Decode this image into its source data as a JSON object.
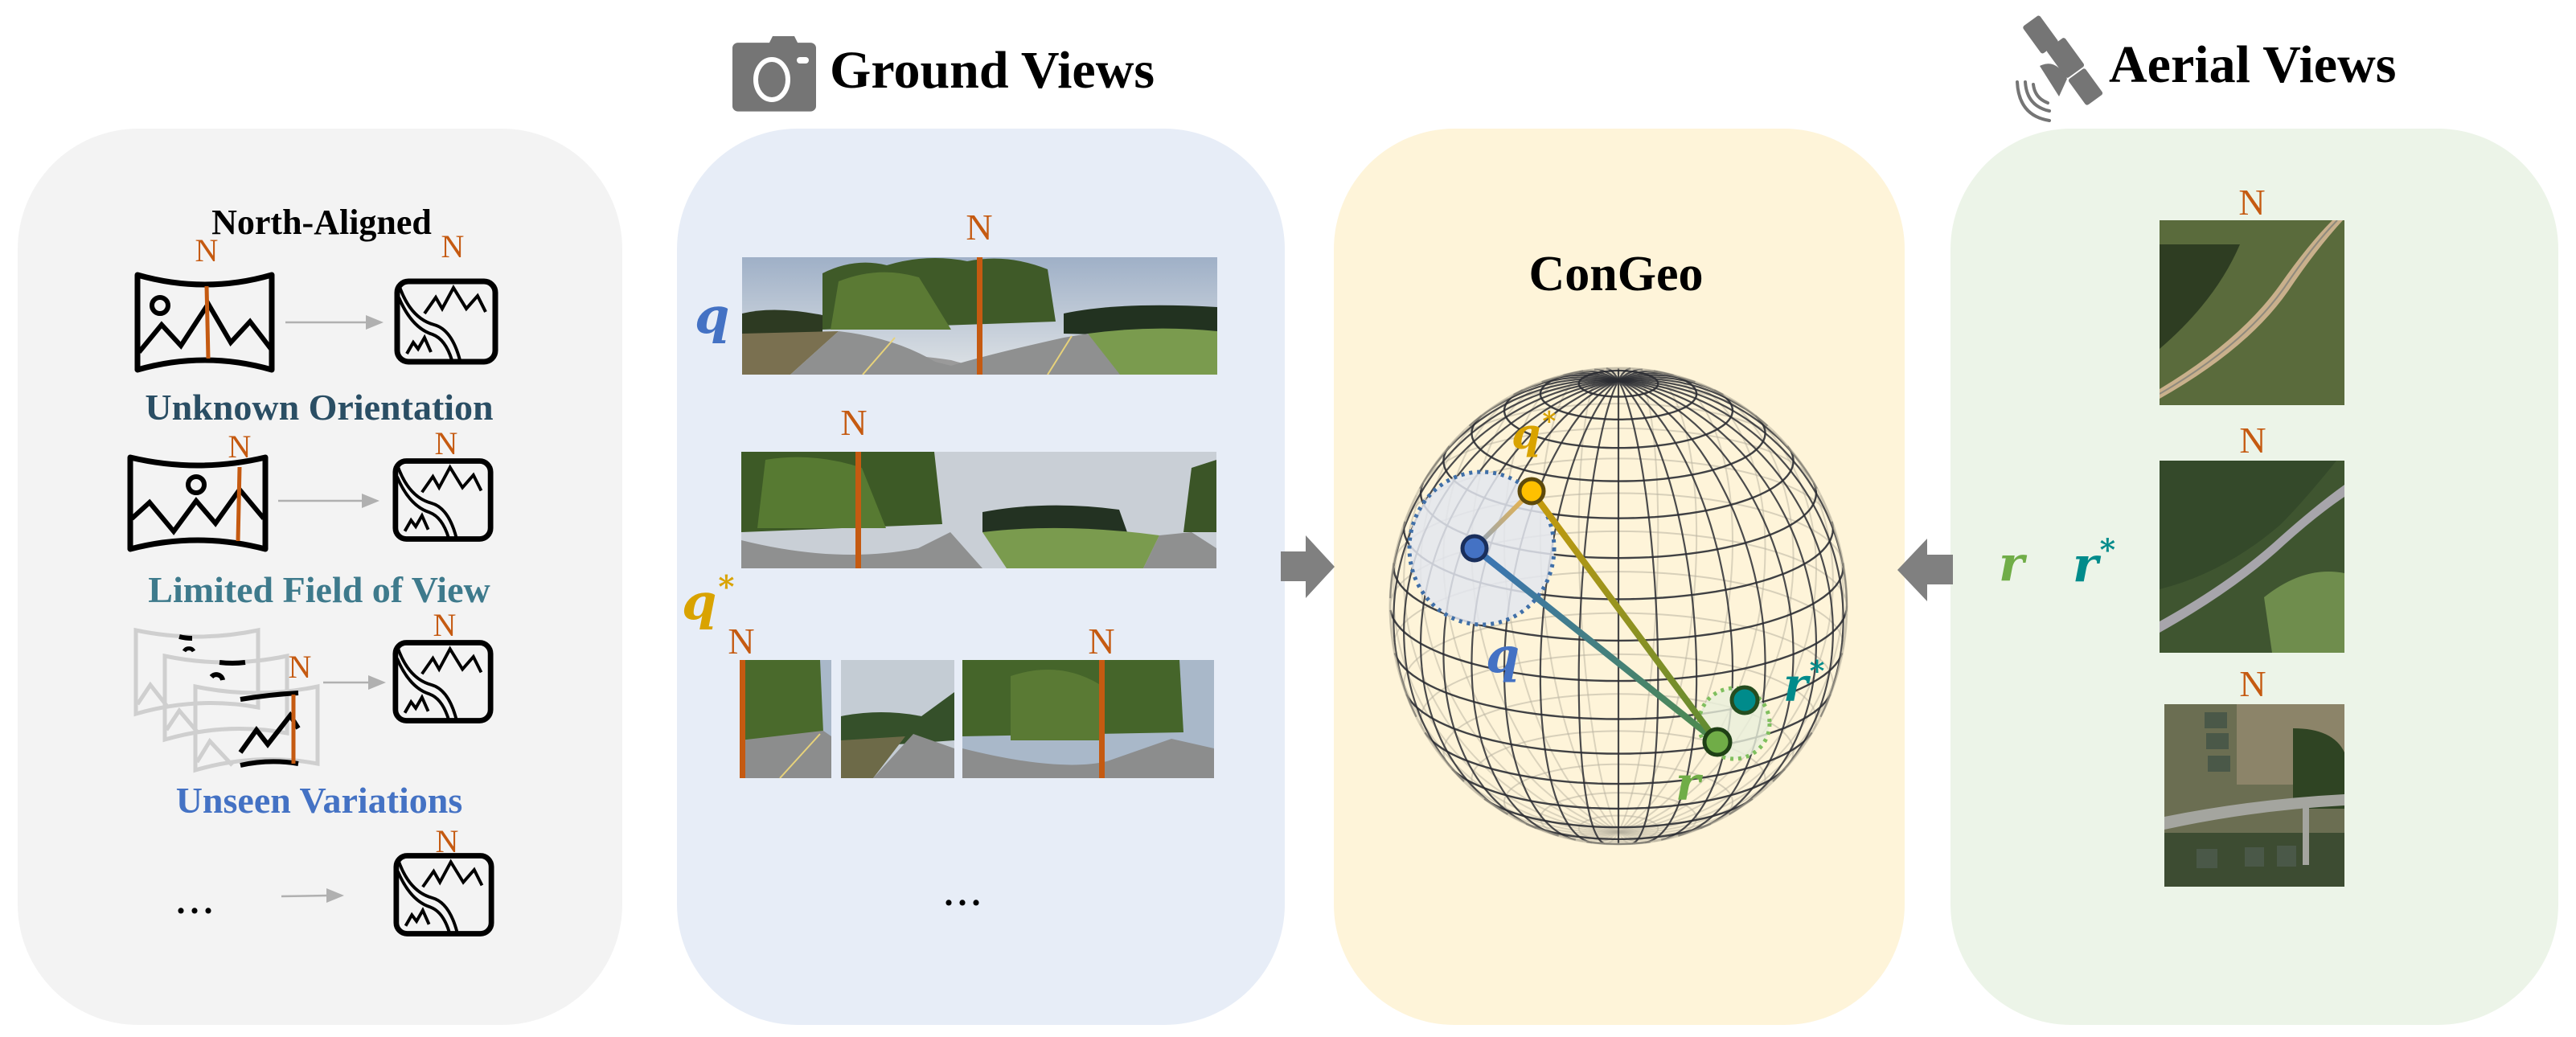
{
  "headers": {
    "ground_views": "Ground Views",
    "aerial_views": "Aerial Views",
    "ground_icon": "camera-icon",
    "aerial_icon": "satellite-icon"
  },
  "left_panel": {
    "title": "North-Aligned",
    "north_label": "N",
    "rows": [
      {
        "id": "north-aligned",
        "source_icon": "panorama-icon",
        "target_icon": "map-icon"
      },
      {
        "id": "unknown-orientation",
        "label": "Unknown Orientation",
        "label_color": "#2a4e64",
        "source_icon": "panorama-icon",
        "target_icon": "map-icon"
      },
      {
        "id": "limited-fov",
        "label": "Limited Field of View",
        "label_color": "#3e7a8c",
        "source_icon": "stacked-partial-panorama-icon",
        "target_icon": "map-icon"
      },
      {
        "id": "unseen-variations",
        "label": "Unseen Variations",
        "label_color": "#4472c4",
        "source_text": "...",
        "target_icon": "map-icon"
      }
    ]
  },
  "ground_panel": {
    "query_label": "q",
    "query_star_label": "q",
    "star": "*",
    "north_label": "N",
    "images": [
      {
        "type": "panorama",
        "role": "query",
        "north_fraction": 0.5
      },
      {
        "type": "panorama",
        "role": "rotated",
        "north_fraction": 0.25
      },
      {
        "type": "crop",
        "role": "limited-fov",
        "north_fraction": 0.0
      },
      {
        "type": "crop",
        "role": "limited-fov"
      },
      {
        "type": "crop",
        "role": "limited-fov",
        "north_fraction": 0.555
      }
    ],
    "more": "..."
  },
  "model_panel": {
    "title": "ConGeo",
    "labels": {
      "q": "q",
      "q_star": "q",
      "r": "r",
      "r_star": "r",
      "star": "*"
    }
  },
  "aerial_panel": {
    "north_label": "N",
    "r_label": "r",
    "r_star_label": "r",
    "star": "*",
    "images": [
      {
        "type": "aerial",
        "scene": "rural-road-field"
      },
      {
        "type": "aerial",
        "scene": "road-through-forest"
      },
      {
        "type": "aerial",
        "scene": "suburban-neighborhood"
      }
    ]
  },
  "colors": {
    "north": "#c55a11",
    "q": "#4472c4",
    "q_star": "#d9a300",
    "r": "#70ad47",
    "r_star": "#008b8b",
    "arrow": "#808080"
  }
}
